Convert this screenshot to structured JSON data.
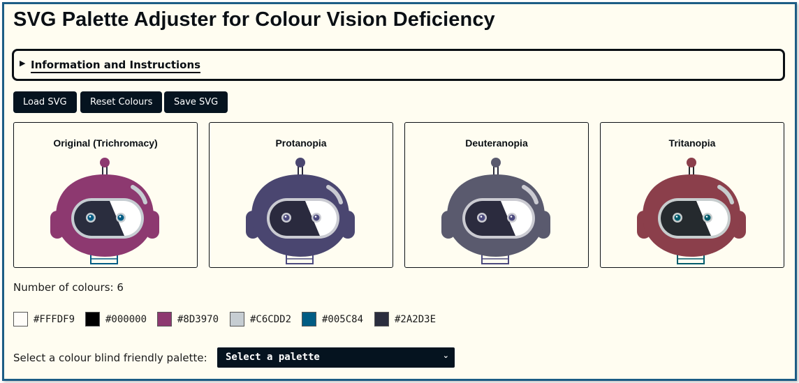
{
  "page": {
    "title": "SVG Palette Adjuster for Colour Vision Deficiency"
  },
  "info": {
    "summary": "Information and Instructions",
    "arrow_icon": "triangle-right-icon"
  },
  "toolbar": {
    "load_label": "Load SVG",
    "reset_label": "Reset Colours",
    "save_label": "Save SVG"
  },
  "previews": [
    {
      "title": "Original (Trichromacy)",
      "head": "#8d3970",
      "dark": "#2a2d3e",
      "eye": "#005c84",
      "light": "#c6cdd2",
      "neck": "#2a2d3e",
      "ring": "#005c84"
    },
    {
      "title": "Protanopia",
      "head": "#4a4670",
      "dark": "#2a2a3e",
      "eye": "#4c4a7e",
      "light": "#cacbd2",
      "neck": "#2a2a3e",
      "ring": "#4c4a7e"
    },
    {
      "title": "Deuteranopia",
      "head": "#5a5a6e",
      "dark": "#2b2b3e",
      "eye": "#4c4a7e",
      "light": "#cbcbd2",
      "neck": "#2b2b3e",
      "ring": "#4c4a7e"
    },
    {
      "title": "Tritanopia",
      "head": "#8b3f4b",
      "dark": "#252a2e",
      "eye": "#005c6c",
      "light": "#c7cdce",
      "neck": "#252a2e",
      "ring": "#005c6c"
    }
  ],
  "colours": {
    "count_label": "Number of colours: 6",
    "swatches": [
      {
        "hex": "#FFFDF9",
        "color": "#FFFDF9"
      },
      {
        "hex": "#000000",
        "color": "#000000"
      },
      {
        "hex": "#8D3970",
        "color": "#8D3970"
      },
      {
        "hex": "#C6CDD2",
        "color": "#C6CDD2"
      },
      {
        "hex": "#005C84",
        "color": "#005C84"
      },
      {
        "hex": "#2A2D3E",
        "color": "#2A2D3E"
      }
    ]
  },
  "palette_select": {
    "label": "Select a colour blind friendly palette:",
    "value": "Select a palette",
    "chevron_icon": "chevron-down-icon"
  },
  "colors": {
    "frame": "#1c5d85",
    "background": "#fffdf1",
    "button_bg": "#05131f"
  }
}
